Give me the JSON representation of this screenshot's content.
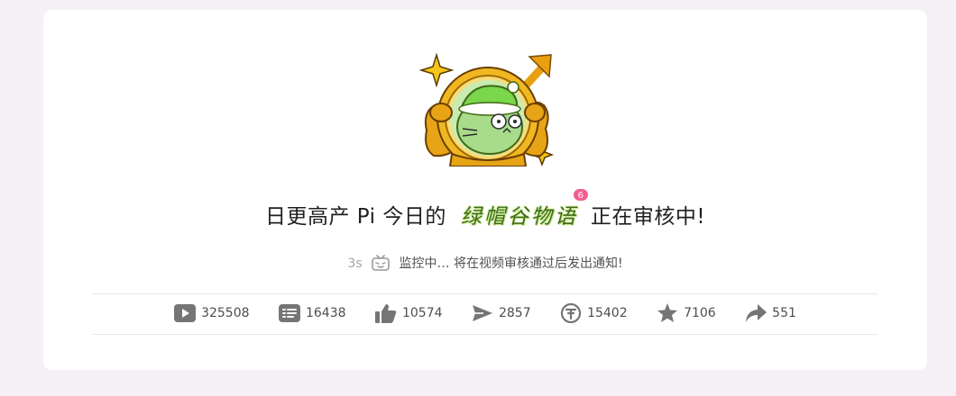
{
  "headline": {
    "prefix": "日更高产 Pi 今日的",
    "video_title": "绿帽谷物语",
    "badge_count": "6",
    "suffix": "正在审核中!"
  },
  "status": {
    "timer": "3s",
    "message": "监控中… 将在视频审核通过后发出通知!"
  },
  "stats": [
    {
      "icon": "play-icon",
      "value": "325508"
    },
    {
      "icon": "danmaku-icon",
      "value": "16438"
    },
    {
      "icon": "thumbs-up-icon",
      "value": "10574"
    },
    {
      "icon": "send-icon",
      "value": "2857"
    },
    {
      "icon": "coin-icon",
      "value": "15402"
    },
    {
      "icon": "star-icon",
      "value": "7106"
    },
    {
      "icon": "share-icon",
      "value": "551"
    }
  ],
  "colors": {
    "accent": "#f25d8e",
    "icon": "#757575",
    "page_bg": "#f4f0f5"
  }
}
